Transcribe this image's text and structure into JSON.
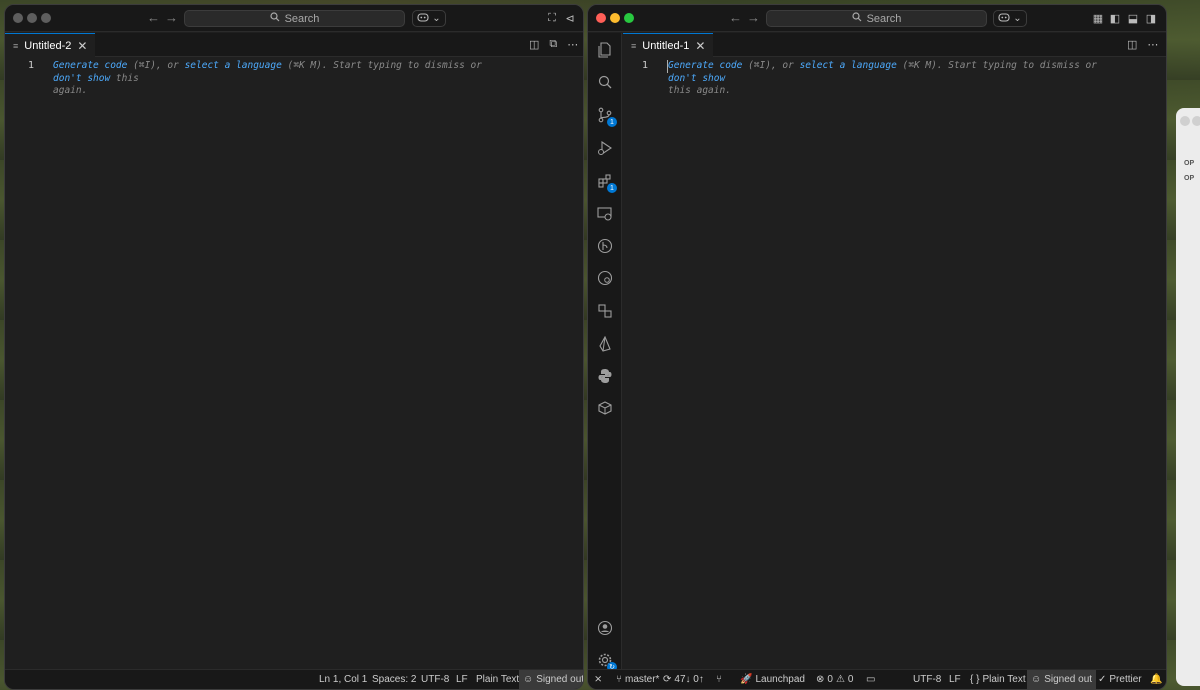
{
  "left_window": {
    "search_label": "Search",
    "tab": {
      "label": "Untitled-2",
      "close": "✕"
    },
    "editor": {
      "line_number": "1",
      "hint_line1": {
        "generate": "Generate code",
        "shortcut1": " (⌘I), or ",
        "select": "select a language",
        "shortcut2": " (⌘K M). Start typing to dismiss or ",
        "dont_show": "don't show",
        "tail": " this"
      },
      "hint_line2": "again."
    },
    "status": {
      "position": "Ln 1, Col 1",
      "spaces": "Spaces: 2",
      "encoding": "UTF-8",
      "eol": "LF",
      "language": "Plain Text",
      "account": "Signed out"
    }
  },
  "right_window": {
    "search_label": "Search",
    "tab": {
      "label": "Untitled-1",
      "close": "✕"
    },
    "editor": {
      "line_number": "1",
      "hint_line1": {
        "generate": "Generate code",
        "shortcut1": " (⌘I), or ",
        "select": "select a language",
        "shortcut2": " (⌘K M). Start typing to dismiss or ",
        "dont_show": "don't show"
      },
      "hint_line2": "this again."
    },
    "activity_badges": {
      "source_control": "1",
      "extensions": "1"
    },
    "status": {
      "branch": "master*",
      "sync": "47↓ 0↑",
      "launchpad": "Launchpad",
      "errors": "0",
      "warnings": "0",
      "encoding": "UTF-8",
      "eol": "LF",
      "language_braces": "{ }",
      "language": "Plain Text",
      "account": "Signed out",
      "formatter": "Prettier"
    }
  },
  "background_window": {
    "labels": [
      "OP",
      "OP"
    ]
  },
  "colors": {
    "editor_bg": "#1f1f1f",
    "chrome_bg": "#181818",
    "accent": "#0078d4",
    "link": "#4daafc",
    "close": "#ff5f57",
    "minimize": "#febc2e",
    "maximize": "#28c840"
  }
}
